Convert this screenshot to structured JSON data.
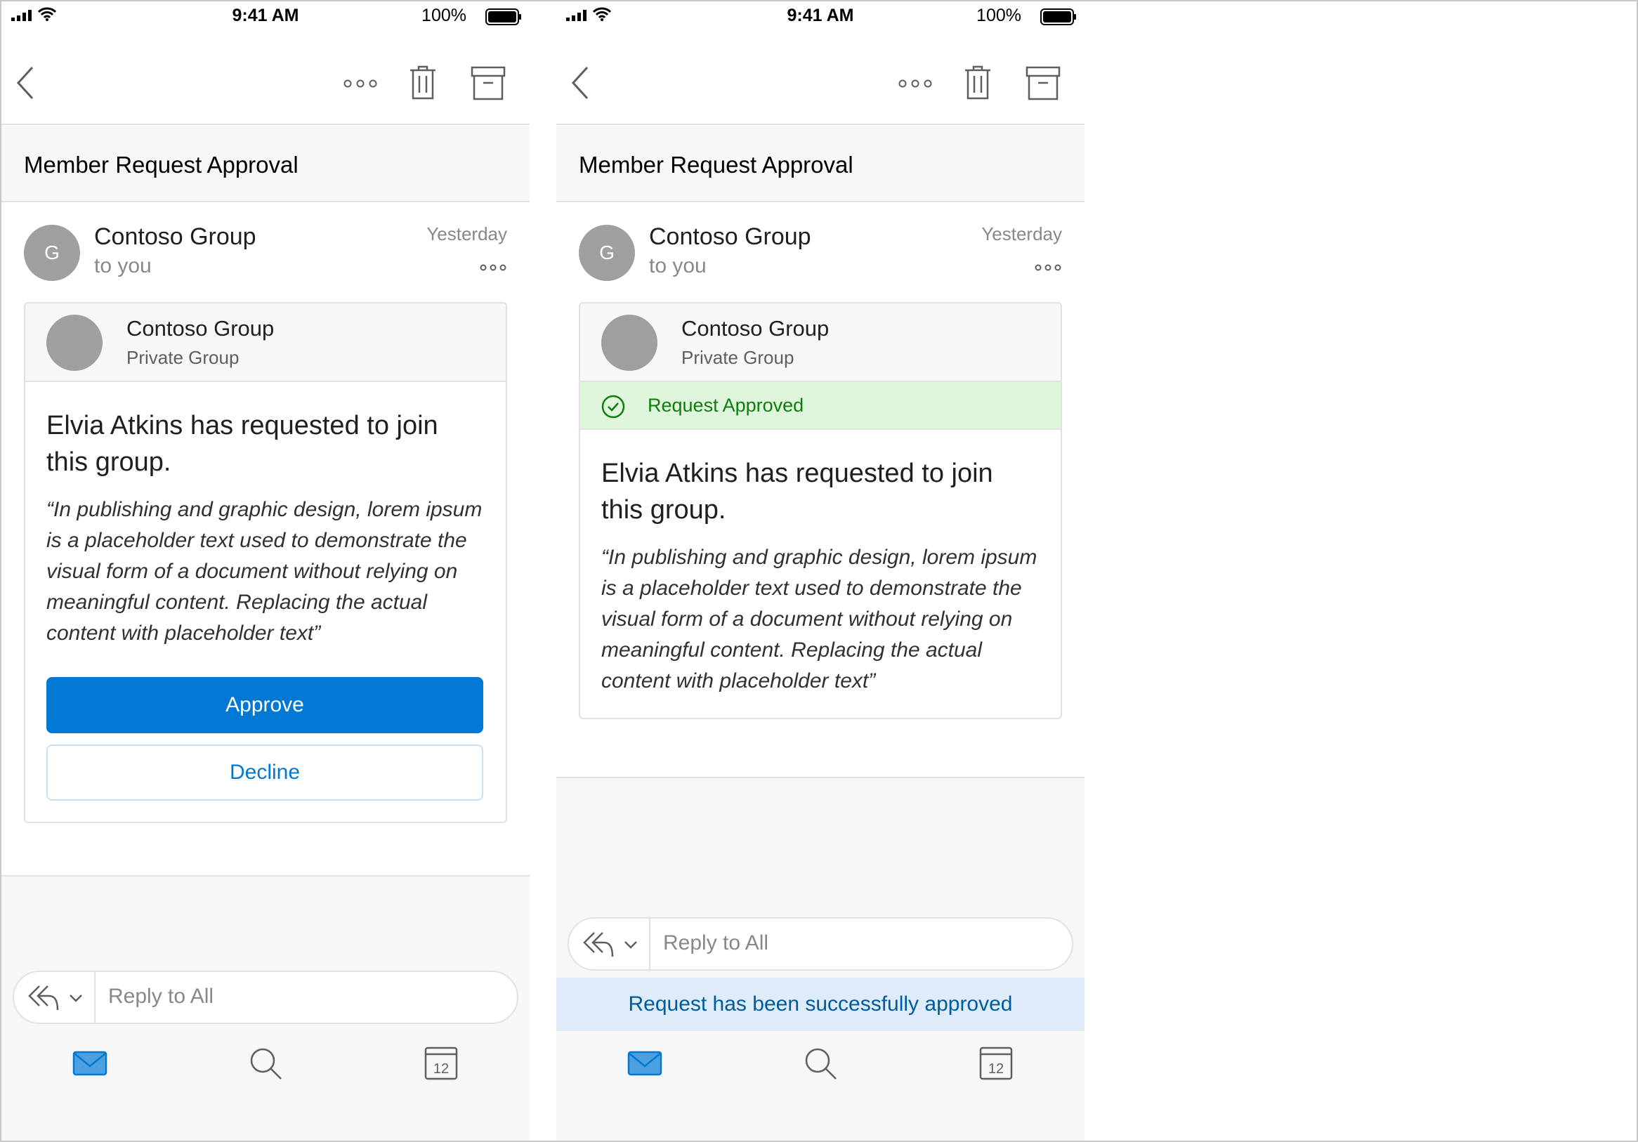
{
  "status_bar": {
    "time": "9:41 AM",
    "battery": "100%"
  },
  "toolbar": {
    "icons": [
      "chevron-left-icon",
      "more-icon",
      "trash-icon",
      "archive-icon"
    ]
  },
  "message": {
    "subject": "Member Request Approval",
    "avatar_initial": "G",
    "sender": "Contoso Group",
    "recipient": "to you",
    "date": "Yesterday"
  },
  "card": {
    "group_name": "Contoso Group",
    "group_type": "Private Group",
    "title": "Elvia Atkins has requested to join this group.",
    "quote": "“In publishing and graphic design, lorem ipsum is a placeholder text used to demonstrate the visual form of a document without relying on meaningful content. Replacing the actual content with placeholder text”",
    "approve_label": "Approve",
    "decline_label": "Decline",
    "approved_label": "Request Approved"
  },
  "reply": {
    "label": "Reply to All"
  },
  "toast": {
    "message": "Request has been successfully approved"
  },
  "tabs": {
    "calendar_day": "12",
    "items": [
      "mail-icon",
      "search-icon",
      "calendar-icon"
    ]
  },
  "colors": {
    "accent": "#0078d4",
    "success": "#107c10",
    "success_bg": "#dff6dd",
    "toast_bg": "#deecf9"
  }
}
